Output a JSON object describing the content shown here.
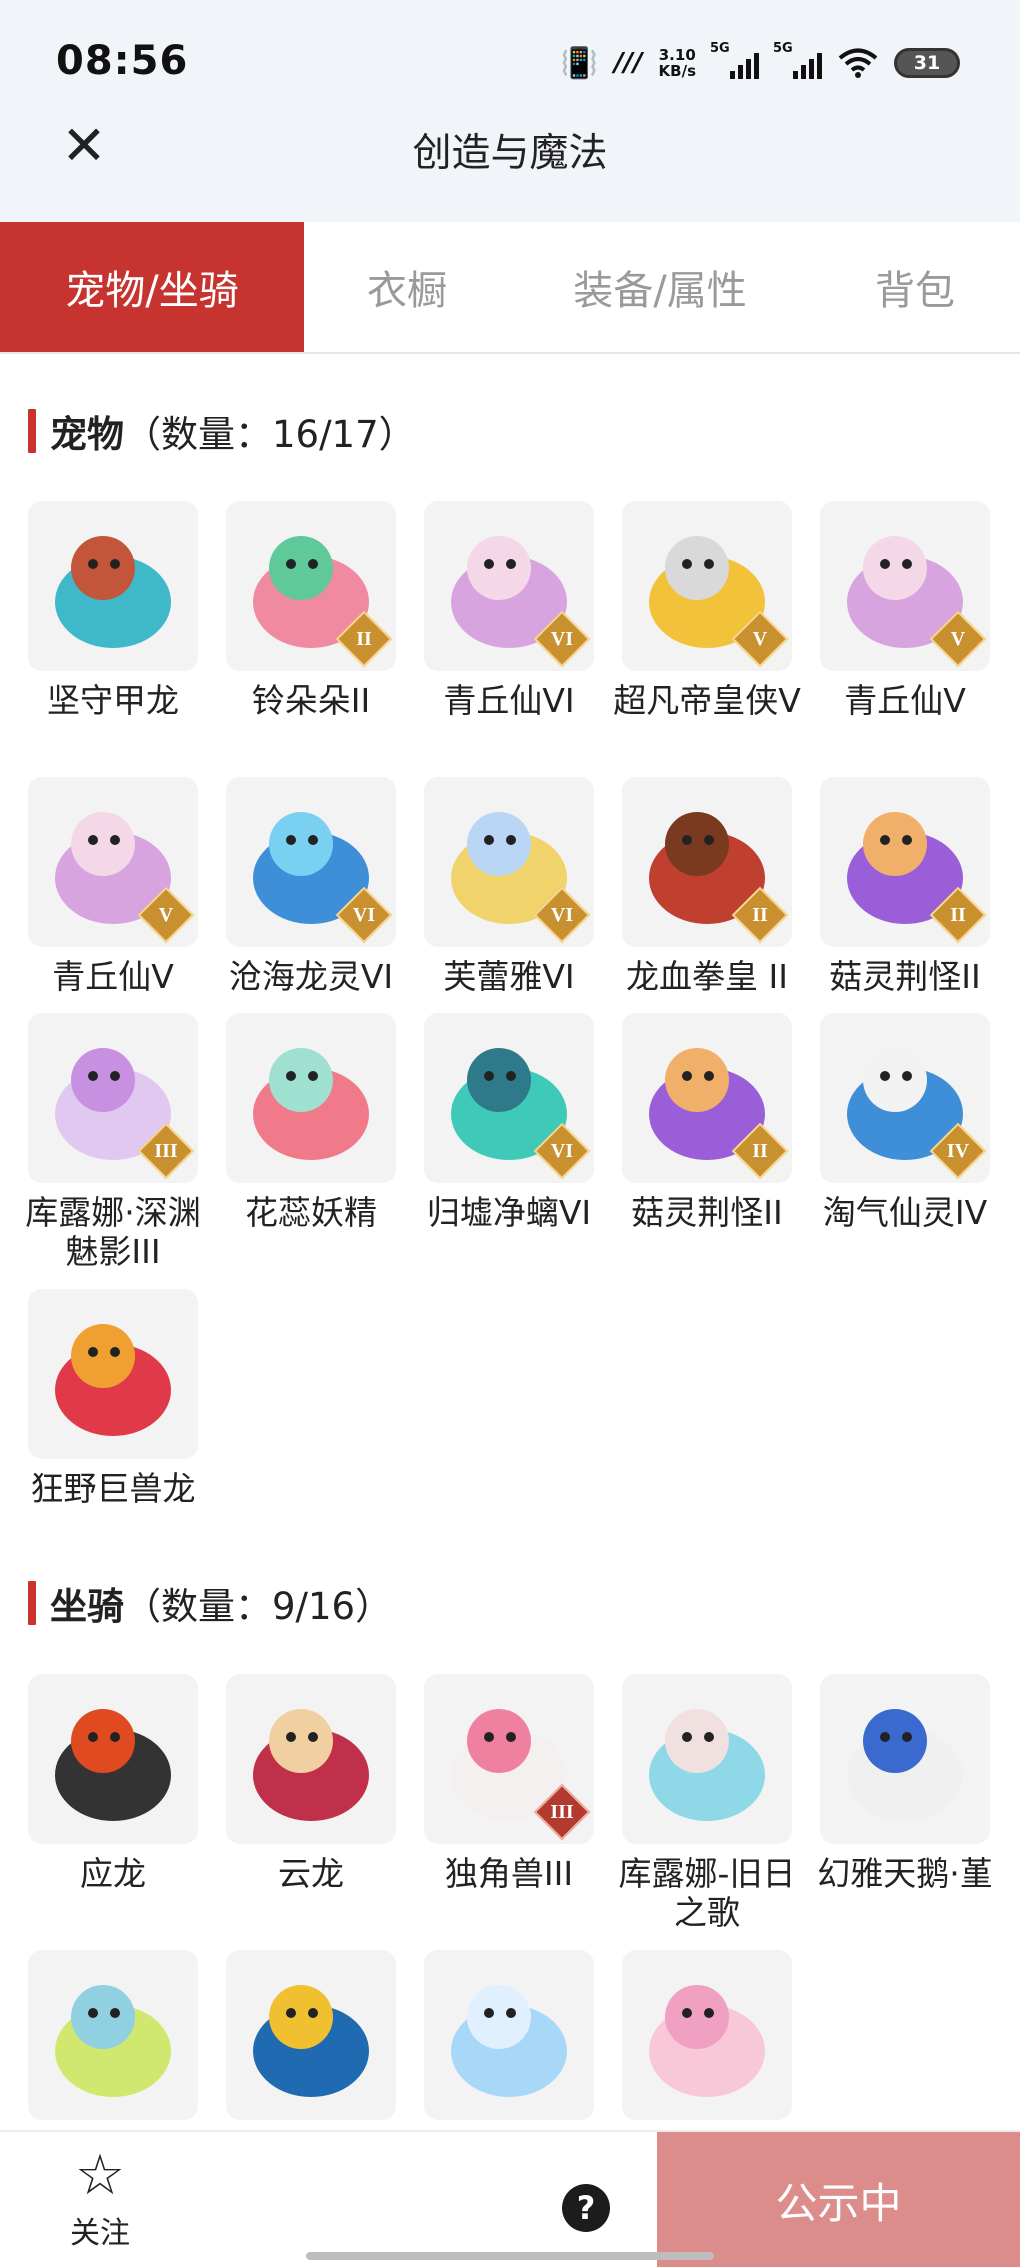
{
  "status_bar": {
    "time": "08:56",
    "net_speed_value": "3.10",
    "net_speed_unit": "KB/s",
    "sim1": "5G",
    "sim2": "5G",
    "battery": "31"
  },
  "header": {
    "title": "创造与魔法",
    "close_icon": "close-icon"
  },
  "tabs": [
    {
      "label": "宠物/坐骑",
      "active": true
    },
    {
      "label": "衣橱",
      "active": false
    },
    {
      "label": "装备/属性",
      "active": false
    },
    {
      "label": "背包",
      "active": false
    }
  ],
  "pets_section": {
    "name": "宠物",
    "count_text": "（数量：16/17）",
    "items": [
      {
        "name": "坚守甲龙",
        "badge": ""
      },
      {
        "name": "铃朵朵II",
        "badge": "II"
      },
      {
        "name": "青丘仙VI",
        "badge": "VI"
      },
      {
        "name": "超凡帝皇侠V",
        "badge": "V"
      },
      {
        "name": "青丘仙V",
        "badge": "V"
      },
      {
        "name": "青丘仙V",
        "badge": "V"
      },
      {
        "name": "沧海龙灵VI",
        "badge": "VI"
      },
      {
        "name": "芙蕾雅VI",
        "badge": "VI"
      },
      {
        "name": "龙血拳皇 II",
        "badge": "II"
      },
      {
        "name": "菇灵荆怪II",
        "badge": "II"
      },
      {
        "name": "库露娜·深渊魅影III",
        "badge": "III"
      },
      {
        "name": "花蕊妖精",
        "badge": ""
      },
      {
        "name": "归墟净螭VI",
        "badge": "VI"
      },
      {
        "name": "菇灵荆怪II",
        "badge": "II"
      },
      {
        "name": "淘气仙灵IV",
        "badge": "IV"
      },
      {
        "name": "狂野巨兽龙",
        "badge": ""
      }
    ]
  },
  "mounts_section": {
    "name": "坐骑",
    "count_text": "（数量：9/16）",
    "items": [
      {
        "name": "应龙",
        "badge": ""
      },
      {
        "name": "云龙",
        "badge": ""
      },
      {
        "name": "独角兽III",
        "badge": "III"
      },
      {
        "name": "库露娜-旧日之歌",
        "badge": ""
      },
      {
        "name": "幻雅天鹅·堇",
        "badge": ""
      },
      {
        "name": "",
        "badge": ""
      },
      {
        "name": "",
        "badge": ""
      },
      {
        "name": "",
        "badge": ""
      },
      {
        "name": "",
        "badge": ""
      }
    ]
  },
  "bottom_bar": {
    "follow_label": "关注",
    "follow_icon": "star-outline-icon",
    "help_label": "?",
    "publish_label": "公示中"
  },
  "colors": {
    "accent": "#c7332f",
    "publish_bg": "#dc8d8b",
    "badge_gold": "#c8902e"
  }
}
